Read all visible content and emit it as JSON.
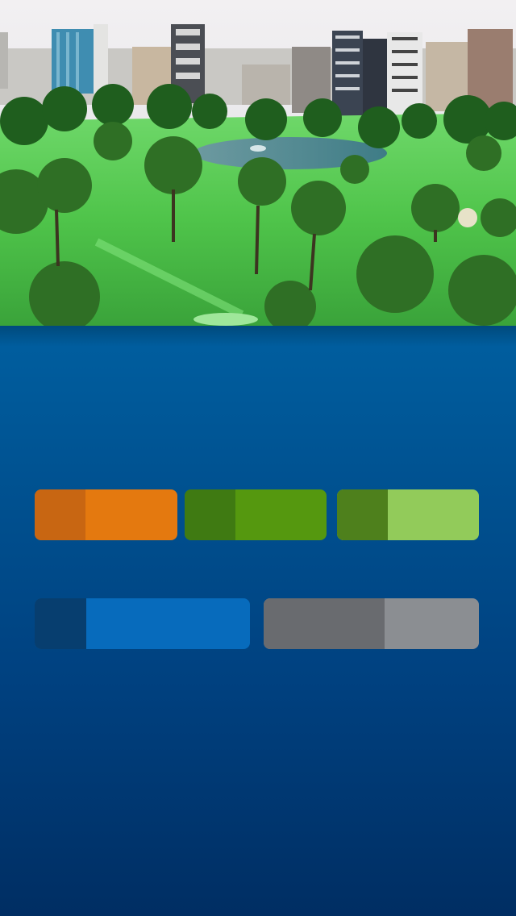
{
  "hero": {
    "image": "golf-course-city-skyline-photo"
  },
  "tiles": [
    {
      "id": "tile-orange",
      "label": "",
      "main": "#e4790f",
      "tab": "#c86612"
    },
    {
      "id": "tile-green",
      "label": "",
      "main": "#55980f",
      "tab": "#3f7a12"
    },
    {
      "id": "tile-lime",
      "label": "",
      "main": "#92cb5a",
      "tab": "#4e801c"
    },
    {
      "id": "tile-blue",
      "label": "",
      "main": "#076bbc",
      "tab": "#073e6f"
    },
    {
      "id": "tile-gray",
      "label": "",
      "main": "#8b8e92",
      "tab": "#696b6f"
    }
  ]
}
